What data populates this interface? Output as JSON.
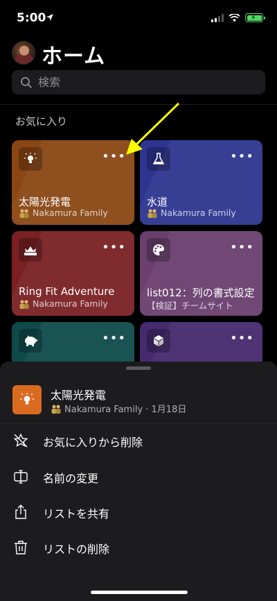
{
  "status_bar": {
    "time": "5:00"
  },
  "header": {
    "title": "ホーム"
  },
  "search": {
    "placeholder": "検索"
  },
  "favorites": {
    "title": "お気に入り",
    "more_label": "•••",
    "cards": [
      {
        "name": "太陽光発電",
        "subtitle": "Nakamura Family",
        "icon": "lightbulb-icon",
        "color": "#8a4613"
      },
      {
        "name": "水道",
        "subtitle": "Nakamura Family",
        "icon": "flask-icon",
        "color": "#2d3590"
      },
      {
        "name": "Ring Fit Adventure",
        "subtitle": "Nakamura Family",
        "icon": "crown-icon",
        "color": "#7a2023"
      },
      {
        "name": "list012：列の書式設定",
        "subtitle": "【検証】チームサイト",
        "icon": "palette-icon",
        "color": "#6a3f6e"
      },
      {
        "name": "",
        "subtitle": "",
        "icon": "piggy-bank-icon",
        "color": "#0e4a4a"
      },
      {
        "name": "",
        "subtitle": "",
        "icon": "cube-icon",
        "color": "#452a6e"
      }
    ]
  },
  "sheet": {
    "title": "太陽光発電",
    "subtitle": "Nakamura Family · 1月18日",
    "actions": [
      {
        "label": "お気に入りから削除",
        "icon": "star-slash-icon"
      },
      {
        "label": "名前の変更",
        "icon": "rename-icon"
      },
      {
        "label": "リストを共有",
        "icon": "share-icon"
      },
      {
        "label": "リストの削除",
        "icon": "trash-icon"
      }
    ]
  },
  "colors": {
    "accent_arrow": "#ffff00",
    "sheet_icon": "#d96b20"
  }
}
